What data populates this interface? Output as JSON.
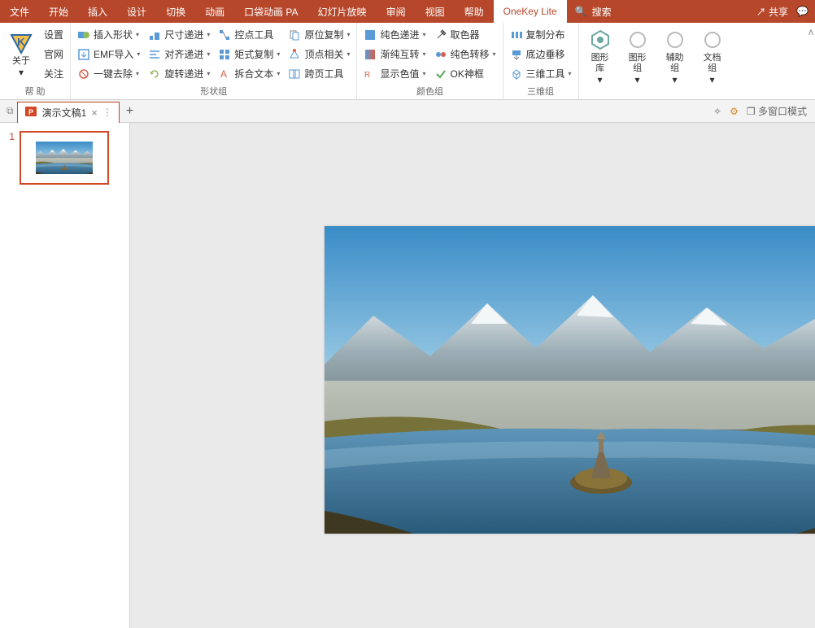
{
  "menubar": {
    "tabs": [
      "文件",
      "开始",
      "插入",
      "设计",
      "切换",
      "动画",
      "口袋动画 PA",
      "幻灯片放映",
      "审阅",
      "视图",
      "帮助",
      "OneKey Lite"
    ],
    "active_index": 11,
    "search_placeholder": "搜索",
    "share": "共享"
  },
  "ribbon": {
    "help": {
      "label": "帮 助",
      "items": [
        "设置",
        "官网",
        "关注"
      ],
      "about": "关于"
    },
    "shape_group": {
      "label": "形状组",
      "col1": [
        "插入形状",
        "EMF导入",
        "一键去除"
      ],
      "col2": [
        "尺寸递进",
        "对齐递进",
        "旋转递进"
      ],
      "col3": [
        "控点工具",
        "矩式复制",
        "拆合文本"
      ],
      "col4": [
        "原位复制",
        "顶点相关",
        "跨页工具"
      ]
    },
    "color_group": {
      "label": "颜色组",
      "col1": [
        "纯色递进",
        "渐纯互转",
        "显示色值"
      ],
      "col2": [
        "取色器",
        "纯色转移",
        "OK神框"
      ]
    },
    "three_group": {
      "label": "三维组",
      "col1": [
        "复制分布",
        "底边垂移",
        "三维工具"
      ]
    },
    "libs": {
      "shape_lib": "图形\n库",
      "shape_set": "图形\n组",
      "aux_set": "辅助\n组",
      "doc_set": "文档\n组"
    }
  },
  "doctab": {
    "name": "演示文稿1",
    "multi_window": "多窗口模式"
  },
  "thumbs": {
    "slides": [
      {
        "num": "1"
      }
    ]
  },
  "colors": {
    "accent": "#b7472a"
  }
}
